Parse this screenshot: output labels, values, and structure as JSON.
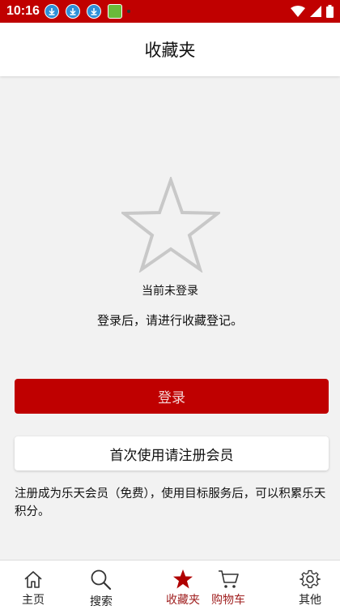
{
  "status_bar": {
    "time": "10:16",
    "notification_icons": [
      "download-icon",
      "download-icon",
      "download-icon",
      "app-icon"
    ],
    "right_icons": [
      "wifi-icon",
      "signal-icon",
      "battery-icon"
    ]
  },
  "header": {
    "title": "收藏夹"
  },
  "empty_state": {
    "icon": "star-outline-icon",
    "message_primary": "当前未登录",
    "message_secondary": "登录后，请进行收藏登记。"
  },
  "actions": {
    "login_label": "登录",
    "register_label": "首次使用请注册会员"
  },
  "note": "注册成为乐天会员（免费），使用目标服务后，可以积累乐天积分。",
  "bottom_nav": {
    "items": [
      {
        "label": "主页",
        "icon": "home-icon"
      },
      {
        "label": "搜索",
        "icon": "search-icon"
      },
      {
        "label": "收藏夹",
        "icon": "star-icon",
        "active": true
      },
      {
        "label": "购物车",
        "icon": "cart-icon"
      },
      {
        "label": "其他",
        "icon": "gear-icon"
      }
    ]
  },
  "colors": {
    "brand": "#bf0000",
    "status_bar": "#c00000",
    "background": "#f2f2f2"
  }
}
